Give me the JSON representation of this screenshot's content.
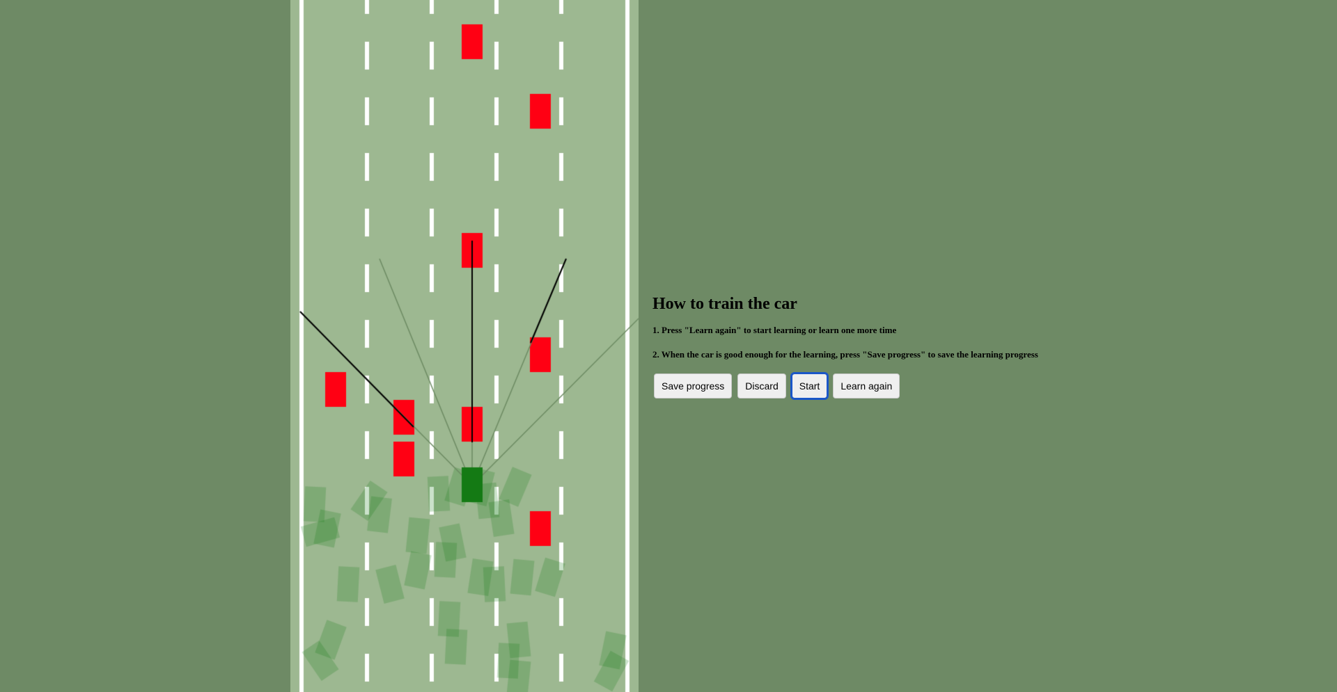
{
  "game": {
    "road_color": "#9db891",
    "shoulder_color": "#6e8a65",
    "edge_line_color": "#ffffff",
    "lane_marking_color": "#ffffff",
    "player_car_color": "#147a14",
    "traffic_car_color": "#ff0013",
    "sensor_color": "#000000",
    "sensor_faded_color": "#6c8a62"
  },
  "panel": {
    "title": "How to train the car",
    "steps": [
      "1. Press \"Learn again\" to start learning or learn one more time",
      "2. When the car is good enough for the learning, press \"Save progress\" to save the learning progress"
    ]
  },
  "buttons": {
    "save": "Save progress",
    "discard": "Discard",
    "start": "Start",
    "learn_again": "Learn again"
  }
}
